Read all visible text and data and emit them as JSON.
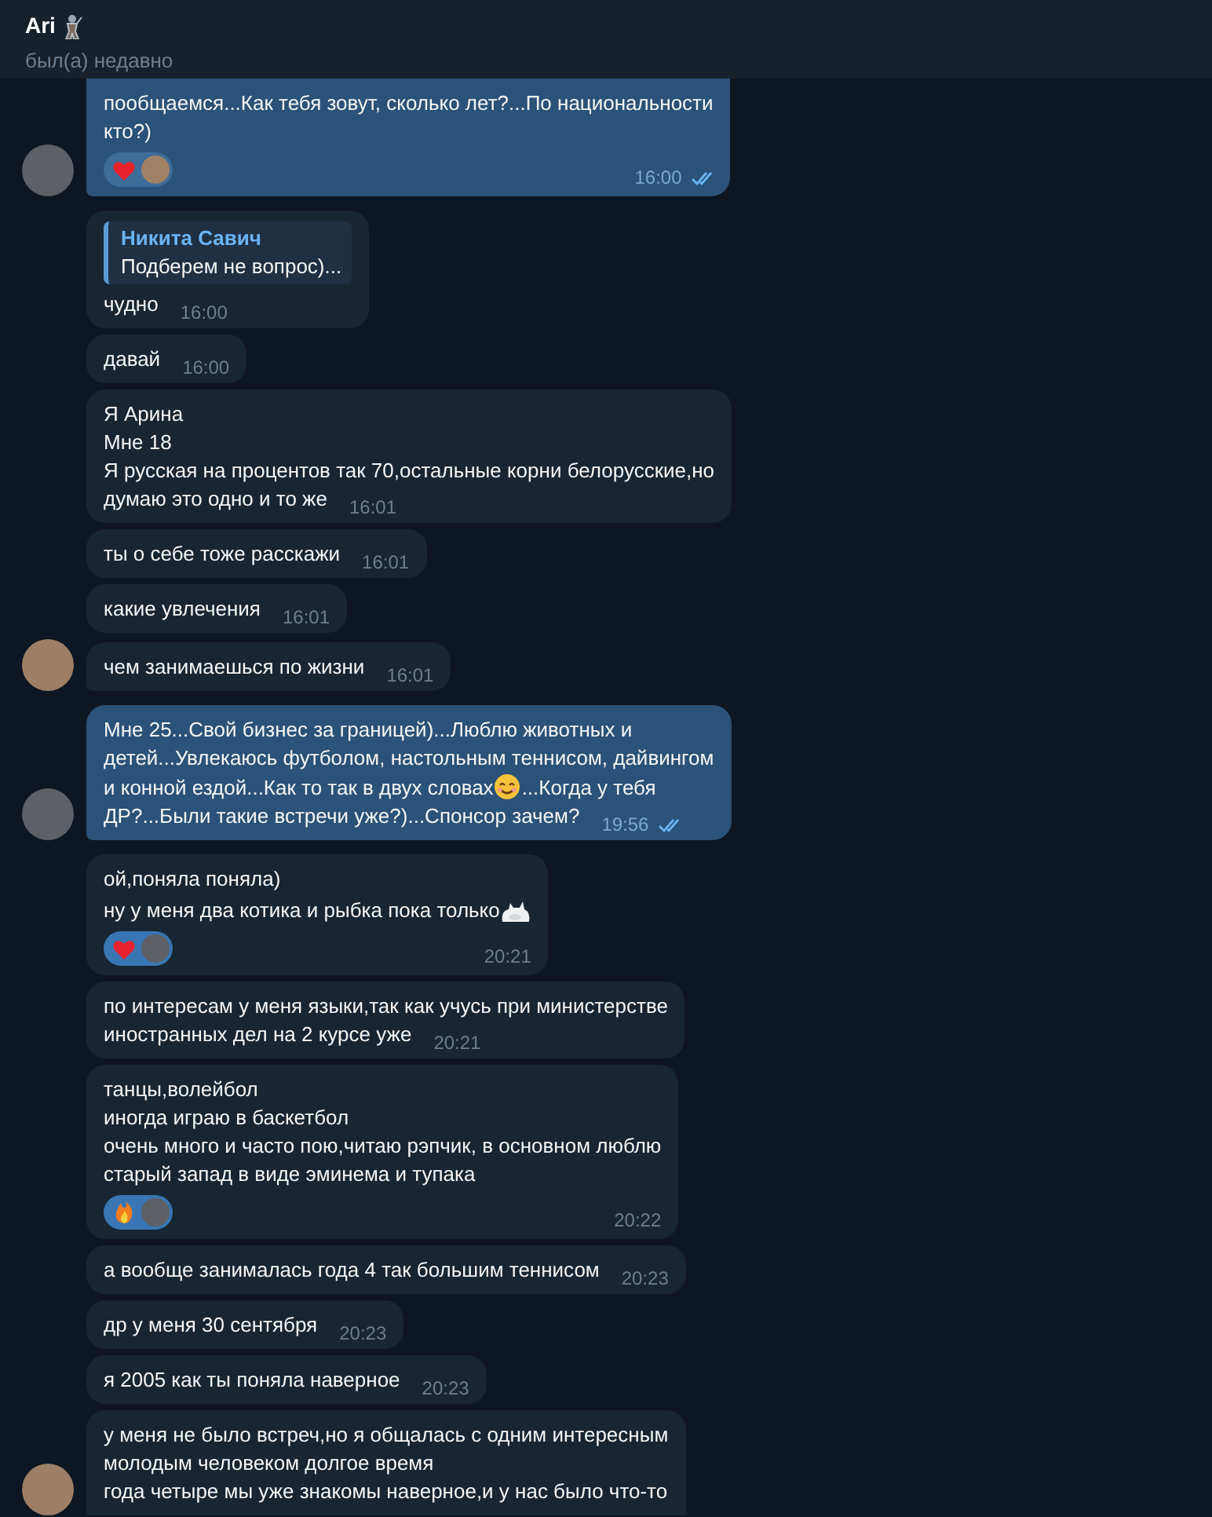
{
  "header": {
    "name": "Ari",
    "status": "был(а) недавно"
  },
  "messages": [
    {
      "outgoing": true,
      "avatar": true,
      "clipped_top": true,
      "parts": [
        {
          "kind": "text",
          "text": "пообщаемся...Как тебя зовут, сколько лет?...По национальности"
        },
        {
          "kind": "break"
        },
        {
          "kind": "text",
          "text": "кто?)"
        }
      ],
      "reactions": [
        {
          "kind": "heart"
        }
      ],
      "time": "16:00",
      "read": true
    },
    {
      "outgoing": false,
      "avatar": false,
      "reply": {
        "author": "Никита Савич",
        "text": "Подберем не вопрос)..."
      },
      "parts": [
        {
          "kind": "text",
          "text": "чудно"
        }
      ],
      "time": "16:00"
    },
    {
      "outgoing": false,
      "avatar": false,
      "parts": [
        {
          "kind": "text",
          "text": "давай"
        }
      ],
      "time": "16:00"
    },
    {
      "outgoing": false,
      "avatar": false,
      "parts": [
        {
          "kind": "text",
          "text": "Я Арина"
        },
        {
          "kind": "break"
        },
        {
          "kind": "text",
          "text": "Мне 18"
        },
        {
          "kind": "break"
        },
        {
          "kind": "text",
          "text": "Я русская на процентов так 70,остальные корни белорусские,но"
        },
        {
          "kind": "break"
        },
        {
          "kind": "text",
          "text": "думаю это одно и то же"
        }
      ],
      "time": "16:01"
    },
    {
      "outgoing": false,
      "avatar": false,
      "parts": [
        {
          "kind": "text",
          "text": "ты о себе тоже расскажи"
        }
      ],
      "time": "16:01"
    },
    {
      "outgoing": false,
      "avatar": false,
      "parts": [
        {
          "kind": "text",
          "text": "какие увлечения"
        }
      ],
      "time": "16:01"
    },
    {
      "outgoing": false,
      "avatar": true,
      "parts": [
        {
          "kind": "text",
          "text": "чем занимаешься по жизни"
        }
      ],
      "time": "16:01"
    },
    {
      "outgoing": true,
      "avatar": true,
      "parts": [
        {
          "kind": "text",
          "text": "Мне 25...Свой бизнес за границей)...Люблю животных и"
        },
        {
          "kind": "break"
        },
        {
          "kind": "text",
          "text": "детей...Увлекаюсь футболом, настольным теннисом, дайвингом"
        },
        {
          "kind": "break"
        },
        {
          "kind": "text",
          "text": "и конной ездой...Как то так в двух словах"
        },
        {
          "kind": "smile"
        },
        {
          "kind": "text",
          "text": "...Когда у тебя"
        },
        {
          "kind": "break"
        },
        {
          "kind": "text",
          "text": "ДР?...Были такие встречи уже?)...Спонсор зачем?"
        }
      ],
      "time": "19:56",
      "read": true
    },
    {
      "outgoing": false,
      "avatar": false,
      "parts": [
        {
          "kind": "text",
          "text": "ой,поняла поняла)"
        },
        {
          "kind": "break"
        },
        {
          "kind": "text",
          "text": "ну у меня два котика и рыбка пока только"
        },
        {
          "kind": "cat"
        }
      ],
      "reactions": [
        {
          "kind": "heart"
        }
      ],
      "time": "20:21"
    },
    {
      "outgoing": false,
      "avatar": false,
      "parts": [
        {
          "kind": "text",
          "text": "по интересам у меня языки,так как учусь при министерстве"
        },
        {
          "kind": "break"
        },
        {
          "kind": "text",
          "text": "иностранных дел на 2 курсе уже"
        }
      ],
      "time": "20:21"
    },
    {
      "outgoing": false,
      "avatar": false,
      "parts": [
        {
          "kind": "text",
          "text": "танцы,волейбол"
        },
        {
          "kind": "break"
        },
        {
          "kind": "text",
          "text": "иногда играю в баскетбол"
        },
        {
          "kind": "break"
        },
        {
          "kind": "text",
          "text": "очень много и часто пою,читаю рэпчик, в основном люблю"
        },
        {
          "kind": "break"
        },
        {
          "kind": "text",
          "text": "старый запад в виде эминема и  тупака"
        }
      ],
      "reactions": [
        {
          "kind": "fire"
        }
      ],
      "time": "20:22"
    },
    {
      "outgoing": false,
      "avatar": false,
      "parts": [
        {
          "kind": "text",
          "text": "а вообще занималась года 4 так большим теннисом"
        }
      ],
      "time": "20:23"
    },
    {
      "outgoing": false,
      "avatar": false,
      "parts": [
        {
          "kind": "text",
          "text": "др у меня 30 сентября"
        }
      ],
      "time": "20:23"
    },
    {
      "outgoing": false,
      "avatar": false,
      "parts": [
        {
          "kind": "text",
          "text": "я 2005 как ты поняла наверное"
        }
      ],
      "time": "20:23"
    },
    {
      "outgoing": false,
      "avatar": true,
      "clipped_bottom": true,
      "parts": [
        {
          "kind": "text",
          "text": "у меня не было встреч,но я общалась с одним интересным"
        },
        {
          "kind": "break"
        },
        {
          "kind": "text",
          "text": "молодым человеком долгое время"
        },
        {
          "kind": "break"
        },
        {
          "kind": "text",
          "text": "года четыре мы уже знакомы наверное,и у нас было что-то"
        }
      ]
    }
  ]
}
